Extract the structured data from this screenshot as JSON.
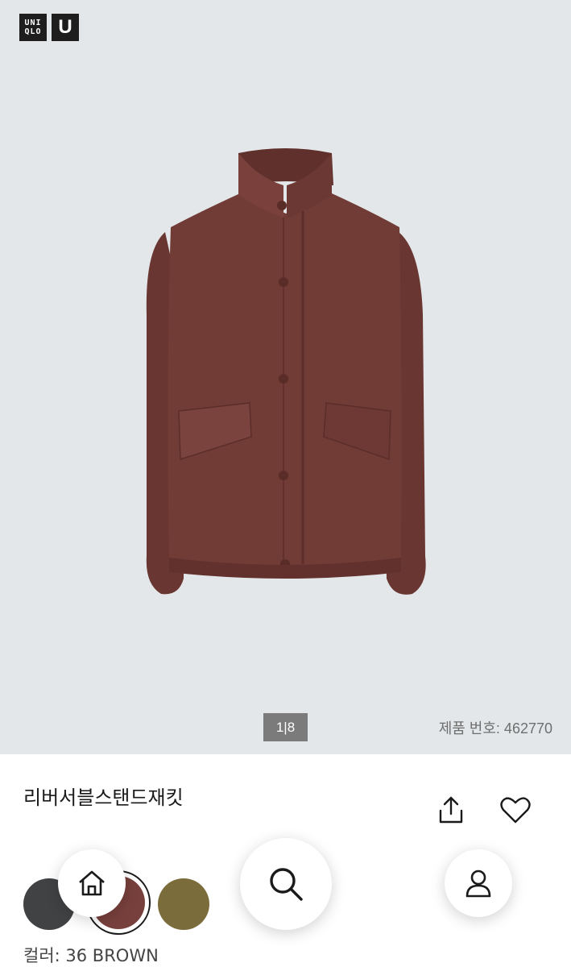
{
  "brand": {
    "logo_uniqlo_line1": "UNI",
    "logo_uniqlo_line2": "QLO",
    "logo_u": "U"
  },
  "gallery": {
    "counter": "1|8",
    "product_number_label": "제품 번호: 462770",
    "background_color": "#e3e7e9"
  },
  "product": {
    "name": "리버서블스탠드재킷",
    "jacket_color": "#6f3a35"
  },
  "actions": {
    "share_icon": "share-icon",
    "favorite_icon": "heart-icon"
  },
  "colors": {
    "swatches": [
      {
        "name": "dark-gray",
        "hex": "#404244"
      },
      {
        "name": "brown",
        "hex": "#78403c",
        "selected": true
      },
      {
        "name": "olive",
        "hex": "#7b6d3b"
      }
    ],
    "selected_label": "컬러: 36 BROWN"
  },
  "floating_nav": {
    "home_icon": "home-icon",
    "search_icon": "search-icon",
    "account_icon": "user-icon"
  }
}
